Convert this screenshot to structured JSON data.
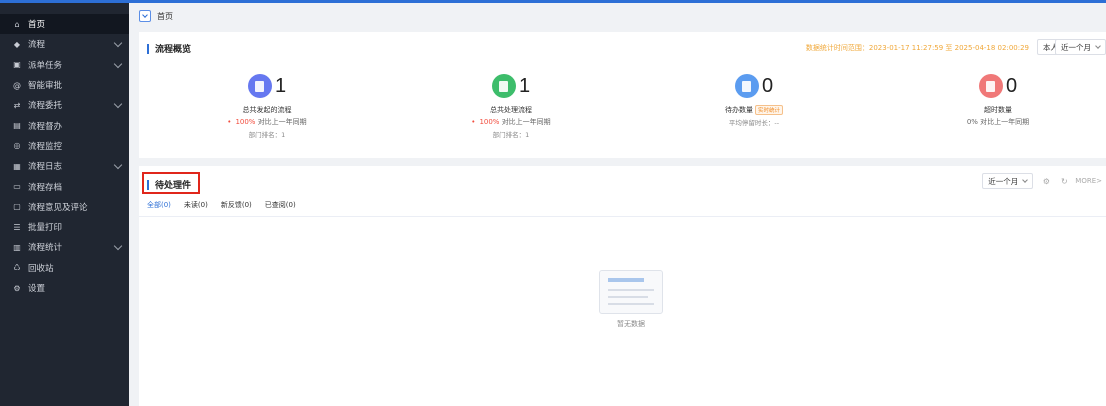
{
  "sidebar": {
    "items": [
      {
        "label": "首页",
        "icon": "home-icon",
        "glyph": "⌂",
        "active": true,
        "has_children": false
      },
      {
        "label": "流程",
        "icon": "layers-icon",
        "glyph": "◆",
        "active": false,
        "has_children": true
      },
      {
        "label": "派单任务",
        "icon": "task-icon",
        "glyph": "▣",
        "active": false,
        "has_children": true
      },
      {
        "label": "智能审批",
        "icon": "at-icon",
        "glyph": "@",
        "active": false,
        "has_children": false
      },
      {
        "label": "流程委托",
        "icon": "delegate-icon",
        "glyph": "⇄",
        "active": false,
        "has_children": true
      },
      {
        "label": "流程督办",
        "icon": "supervise-icon",
        "glyph": "▤",
        "active": false,
        "has_children": false
      },
      {
        "label": "流程监控",
        "icon": "monitor-icon",
        "glyph": "◎",
        "active": false,
        "has_children": false
      },
      {
        "label": "流程日志",
        "icon": "log-icon",
        "glyph": "▦",
        "active": false,
        "has_children": true
      },
      {
        "label": "流程存档",
        "icon": "archive-icon",
        "glyph": "▭",
        "active": false,
        "has_children": false
      },
      {
        "label": "流程意见及评论",
        "icon": "comment-icon",
        "glyph": "▢",
        "active": false,
        "has_children": false
      },
      {
        "label": "批量打印",
        "icon": "print-icon",
        "glyph": "☰",
        "active": false,
        "has_children": false
      },
      {
        "label": "流程统计",
        "icon": "stats-icon",
        "glyph": "▥",
        "active": false,
        "has_children": true
      },
      {
        "label": "回收站",
        "icon": "trash-icon",
        "glyph": "♺",
        "active": false,
        "has_children": false
      },
      {
        "label": "设置",
        "icon": "settings-icon",
        "glyph": "⚙",
        "active": false,
        "has_children": false
      }
    ]
  },
  "breadcrumb": {
    "current": "首页"
  },
  "overview": {
    "title": "流程概览",
    "range_text": "数据统计时间范围：2023-01-17 11:27:59 至 2025-04-18 02:00:29",
    "scope_select": "本人",
    "period_select": "近一个月",
    "stats": [
      {
        "value": "1",
        "label": "总共发起的流程",
        "compare_pct": "100%",
        "compare_text": "对比上一年同期",
        "sub": "部门排名：1",
        "color": "#6678f0"
      },
      {
        "value": "1",
        "label": "总共处理流程",
        "compare_pct": "100%",
        "compare_text": "对比上一年同期",
        "sub": "部门排名：1",
        "color": "#3dbd6b"
      },
      {
        "value": "0",
        "label": "待办数量",
        "badge": "实时统计",
        "sub": "平均停留时长：--",
        "color": "#5b9cf0"
      },
      {
        "value": "0",
        "label": "超时数量",
        "compare_pct": "0%",
        "compare_text": "对比上一年同期",
        "color": "#f07878"
      }
    ]
  },
  "pending": {
    "title": "待处理件",
    "period_select": "近一个月",
    "more_label": "MORE>",
    "tabs": [
      {
        "label": "全部(0)",
        "active": true
      },
      {
        "label": "未读(0)",
        "active": false
      },
      {
        "label": "新反馈(0)",
        "active": false
      },
      {
        "label": "已查阅(0)",
        "active": false
      }
    ],
    "empty_text": "暂无数据"
  },
  "colors": {
    "sidebar_bg": "#202631",
    "accent": "#2d6fd6",
    "highlight_box": "#e0261b",
    "range_text": "#f0a83a"
  }
}
